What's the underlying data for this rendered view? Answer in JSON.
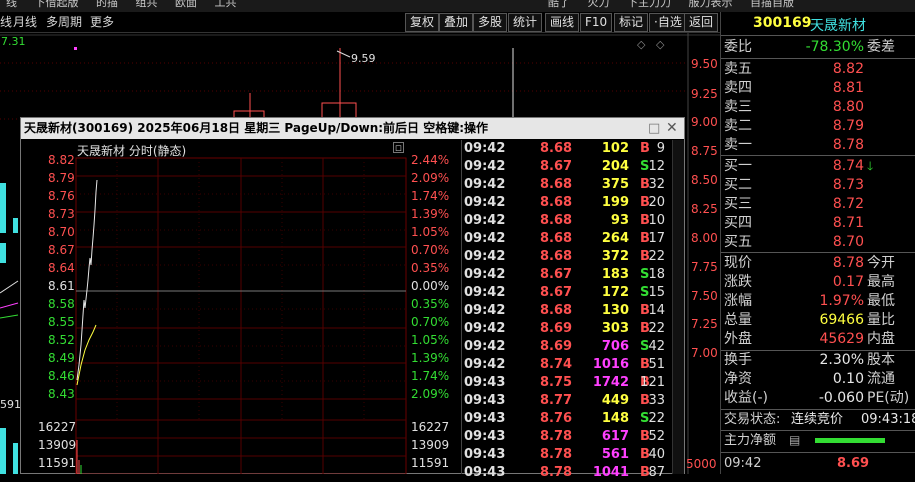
{
  "topbar": {
    "items": [
      "线",
      "下借起版",
      "的描",
      "组共",
      "欧面",
      "工共",
      "酷了",
      "火力",
      "下主力力",
      "服力表示",
      "自描自版"
    ]
  },
  "toolbar": {
    "left": [
      "线",
      "月线",
      "多周期",
      "更多"
    ],
    "right": [
      "复权",
      "叠加",
      "多股",
      "统计",
      "画线",
      "F10",
      "标记",
      "·自选",
      "返回"
    ]
  },
  "mainchart": {
    "prev_close_label": "7.31",
    "high_label": "9.59",
    "axis": [
      "9.50",
      "9.25",
      "9.00",
      "8.75",
      "8.50",
      "8.25",
      "8.00",
      "7.75",
      "7.50",
      "7.25",
      "7.00",
      "5000"
    ],
    "left_values": [
      "591"
    ]
  },
  "popup": {
    "title": "天晟新材(300169) 2025年06月18日 星期三 PageUp/Down:前后日 空格键:操作",
    "chart_title": "天晟新材  分时(静态)",
    "price_axis": [
      "8.82",
      "8.79",
      "8.76",
      "8.73",
      "8.70",
      "8.67",
      "8.64",
      "8.61",
      "8.58",
      "8.55",
      "8.52",
      "8.49",
      "8.46",
      "8.43"
    ],
    "pct_axis": [
      "2.44%",
      "2.09%",
      "1.74%",
      "1.39%",
      "1.05%",
      "0.70%",
      "0.35%",
      "0.00%",
      "0.35%",
      "0.70%",
      "1.05%",
      "1.39%",
      "1.74%",
      "2.09%"
    ],
    "vol_axis": [
      "16227",
      "13909",
      "11591"
    ]
  },
  "ticks": [
    {
      "t": "09:42",
      "p": "8.68",
      "v": "102",
      "s": "B",
      "n": "9",
      "pc": "red",
      "vc": "yel",
      "sc": "red"
    },
    {
      "t": "09:42",
      "p": "8.67",
      "v": "204",
      "s": "S",
      "n": "12",
      "pc": "red",
      "vc": "yel",
      "sc": "grn"
    },
    {
      "t": "09:42",
      "p": "8.68",
      "v": "375",
      "s": "B",
      "n": "32",
      "pc": "red",
      "vc": "yel",
      "sc": "red"
    },
    {
      "t": "09:42",
      "p": "8.68",
      "v": "199",
      "s": "B",
      "n": "20",
      "pc": "red",
      "vc": "yel",
      "sc": "red"
    },
    {
      "t": "09:42",
      "p": "8.68",
      "v": "93",
      "s": "B",
      "n": "10",
      "pc": "red",
      "vc": "yel",
      "sc": "red"
    },
    {
      "t": "09:42",
      "p": "8.68",
      "v": "264",
      "s": "B",
      "n": "17",
      "pc": "red",
      "vc": "yel",
      "sc": "red"
    },
    {
      "t": "09:42",
      "p": "8.68",
      "v": "372",
      "s": "B",
      "n": "22",
      "pc": "red",
      "vc": "yel",
      "sc": "red"
    },
    {
      "t": "09:42",
      "p": "8.67",
      "v": "183",
      "s": "S",
      "n": "18",
      "pc": "red",
      "vc": "yel",
      "sc": "grn"
    },
    {
      "t": "09:42",
      "p": "8.67",
      "v": "172",
      "s": "S",
      "n": "15",
      "pc": "red",
      "vc": "yel",
      "sc": "grn"
    },
    {
      "t": "09:42",
      "p": "8.68",
      "v": "130",
      "s": "B",
      "n": "14",
      "pc": "red",
      "vc": "yel",
      "sc": "red"
    },
    {
      "t": "09:42",
      "p": "8.69",
      "v": "303",
      "s": "B",
      "n": "22",
      "pc": "red",
      "vc": "yel",
      "sc": "red"
    },
    {
      "t": "09:42",
      "p": "8.69",
      "v": "706",
      "s": "S",
      "n": "42",
      "pc": "red",
      "vc": "mag",
      "sc": "grn"
    },
    {
      "t": "09:42",
      "p": "8.74",
      "v": "1016",
      "s": "B",
      "n": "51",
      "pc": "red",
      "vc": "mag",
      "sc": "red"
    },
    {
      "t": "09:43",
      "p": "8.75",
      "v": "1742",
      "s": "B",
      "n": "121",
      "pc": "red",
      "vc": "mag",
      "sc": "red"
    },
    {
      "t": "09:43",
      "p": "8.77",
      "v": "449",
      "s": "B",
      "n": "33",
      "pc": "red",
      "vc": "yel",
      "sc": "red"
    },
    {
      "t": "09:43",
      "p": "8.76",
      "v": "148",
      "s": "S",
      "n": "22",
      "pc": "red",
      "vc": "yel",
      "sc": "grn"
    },
    {
      "t": "09:43",
      "p": "8.78",
      "v": "617",
      "s": "B",
      "n": "52",
      "pc": "red",
      "vc": "mag",
      "sc": "red"
    },
    {
      "t": "09:43",
      "p": "8.78",
      "v": "561",
      "s": "B",
      "n": "40",
      "pc": "red",
      "vc": "mag",
      "sc": "red"
    },
    {
      "t": "09:43",
      "p": "8.78",
      "v": "1041",
      "s": "B",
      "n": "87",
      "pc": "red",
      "vc": "mag",
      "sc": "red"
    }
  ],
  "rpanel": {
    "code": "300169",
    "name": "天晟新材",
    "weibi": {
      "label": "委比",
      "value": "-78.30%",
      "label2": "委差"
    },
    "sells": [
      {
        "label": "卖五",
        "price": "8.82"
      },
      {
        "label": "卖四",
        "price": "8.81"
      },
      {
        "label": "卖三",
        "price": "8.80"
      },
      {
        "label": "卖二",
        "price": "8.79"
      },
      {
        "label": "卖一",
        "price": "8.78"
      }
    ],
    "buys": [
      {
        "label": "买一",
        "price": "8.74"
      },
      {
        "label": "买二",
        "price": "8.73"
      },
      {
        "label": "买三",
        "price": "8.72"
      },
      {
        "label": "买四",
        "price": "8.71"
      },
      {
        "label": "买五",
        "price": "8.70"
      }
    ],
    "stats": [
      {
        "label": "现价",
        "value": "8.78",
        "label2": "今开",
        "vc": "red"
      },
      {
        "label": "涨跌",
        "value": "0.17",
        "label2": "最高",
        "vc": "red"
      },
      {
        "label": "涨幅",
        "value": "1.97%",
        "label2": "最低",
        "vc": "red"
      },
      {
        "label": "总量",
        "value": "69466",
        "label2": "量比",
        "vc": "yel"
      },
      {
        "label": "外盘",
        "value": "45629",
        "label2": "内盘",
        "vc": "red"
      }
    ],
    "stats2": [
      {
        "label": "换手",
        "value": "2.30%",
        "label2": "股本",
        "vc": "wht"
      },
      {
        "label": "净资",
        "value": "0.10",
        "label2": "流通",
        "vc": "wht"
      },
      {
        "label": "收益(-)",
        "value": "-0.060",
        "label2": "PE(动)",
        "vc": "wht"
      }
    ],
    "trade_state": {
      "label": "交易状态:",
      "value": "连续竞价",
      "time": "09:43:18"
    },
    "main_flow": {
      "label": "主力净额"
    },
    "last_tick": {
      "t": "09:42",
      "p": "8.69"
    }
  },
  "colors": {
    "red": "#ff5050",
    "green": "#33dd33",
    "yellow": "#ffff40",
    "magenta": "#ff40ff",
    "cyan": "#40e0e0",
    "grid": "#550000"
  }
}
